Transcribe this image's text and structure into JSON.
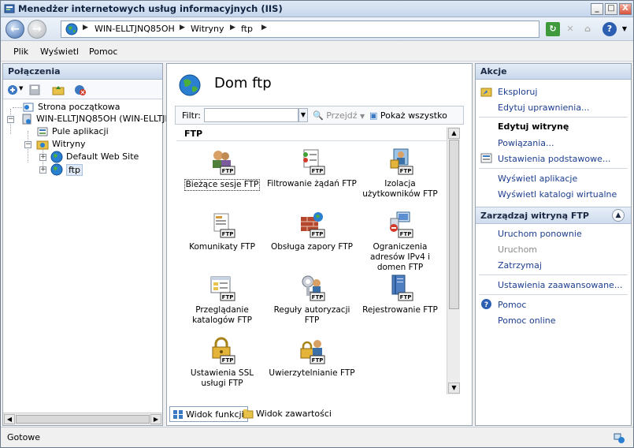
{
  "window": {
    "title": "Menedżer internetowych usług informacyjnych (IIS)",
    "controls": {
      "minimize": "_",
      "maximize": "□",
      "close": "X"
    }
  },
  "address_bar": {
    "crumbs": [
      "WIN-ELLTJNQ85OH",
      "Witryny",
      "ftp"
    ]
  },
  "menu": {
    "items": [
      "Plik",
      "Wyświetl",
      "Pomoc"
    ]
  },
  "connections": {
    "header": "Połączenia",
    "tree": {
      "start_page": "Strona początkowa",
      "server": "WIN-ELLTJNQ85OH (WIN-ELLTJN",
      "app_pools": "Pule aplikacji",
      "sites": "Witryny",
      "default_site": "Default Web Site",
      "ftp_site": "ftp"
    }
  },
  "main": {
    "title": "Dom ftp",
    "filter": {
      "label": "Filtr:",
      "value": "",
      "go_label": "Przejdź",
      "show_all_label": "Pokaż wszystko"
    },
    "group_label": "FTP",
    "features": [
      {
        "label": "Bieżące sesje FTP",
        "icon": "ftp-current-sessions-icon"
      },
      {
        "label": "Filtrowanie żądań FTP",
        "icon": "ftp-request-filtering-icon"
      },
      {
        "label": "Izolacja użytkowników FTP",
        "icon": "ftp-user-isolation-icon"
      },
      {
        "label": "Komunikaty FTP",
        "icon": "ftp-messages-icon"
      },
      {
        "label": "Obsługa zapory FTP",
        "icon": "ftp-firewall-support-icon"
      },
      {
        "label": "Ograniczenia adresów IPv4 i domen FTP",
        "icon": "ftp-ip-domain-restrictions-icon"
      },
      {
        "label": "Przeglądanie katalogów FTP",
        "icon": "ftp-directory-browsing-icon"
      },
      {
        "label": "Reguły autoryzacji FTP",
        "icon": "ftp-authorization-rules-icon"
      },
      {
        "label": "Rejestrowanie FTP",
        "icon": "ftp-logging-icon"
      },
      {
        "label": "Ustawienia SSL usługi FTP",
        "icon": "ftp-ssl-settings-icon"
      },
      {
        "label": "Uwierzytelnianie FTP",
        "icon": "ftp-authentication-icon"
      }
    ],
    "view_tabs": {
      "features_view": "Widok funkcji",
      "content_view": "Widok zawartości"
    }
  },
  "actions": {
    "header": "Akcje",
    "explore": "Eksploruj",
    "edit_permissions": "Edytuj uprawnienia...",
    "edit_site_heading": "Edytuj witrynę",
    "bindings": "Powiązania...",
    "basic_settings": "Ustawienia podstawowe...",
    "view_applications": "Wyświetl aplikacje",
    "view_virtual_dirs": "Wyświetl katalogi wirtualne",
    "manage_section": "Zarządzaj witryną FTP",
    "restart": "Uruchom ponownie",
    "start": "Uruchom",
    "stop": "Zatrzymaj",
    "advanced_settings": "Ustawienia zaawansowane...",
    "help": "Pomoc",
    "online_help": "Pomoc online"
  },
  "status": {
    "text": "Gotowe"
  },
  "colors": {
    "link": "#1d3e8f",
    "disabled": "#8b8b8b",
    "header_gradient_top": "#e4ecf7",
    "header_gradient_bottom": "#c9d8ed"
  }
}
